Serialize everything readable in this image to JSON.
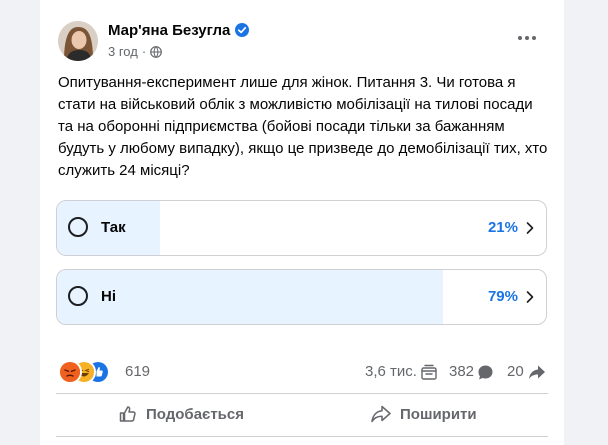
{
  "post": {
    "author": "Мар'яна Безугла",
    "time": "3 год",
    "text": "Опитування-експеримент лише для жінок. Питання 3. Чи готова я стати на військовий облік з можливістю мобілізації на тилові посади та на оборонні підприємства (бойові посади тільки за бажанням будуть у любому випадку), якщо це призведе до демобілізації тих, хто служить 24 місяці?"
  },
  "poll": {
    "options": [
      {
        "label": "Так",
        "percent_text": "21%",
        "percent": 21
      },
      {
        "label": "Ні",
        "percent_text": "79%",
        "percent": 79
      }
    ]
  },
  "stats": {
    "reactions_count": "619",
    "views": "3,6 тис.",
    "comments": "382",
    "shares": "20"
  },
  "actions": {
    "like": "Подобається",
    "share": "Поширити"
  },
  "icons": {
    "reactions": [
      "angry-icon",
      "haha-icon",
      "like-icon"
    ],
    "verified": "verified-badge-icon",
    "audience": "globe-icon"
  },
  "colors": {
    "accent": "#1b74e4",
    "poll_fill": "#e7f3ff",
    "secondary_text": "#65676b"
  }
}
